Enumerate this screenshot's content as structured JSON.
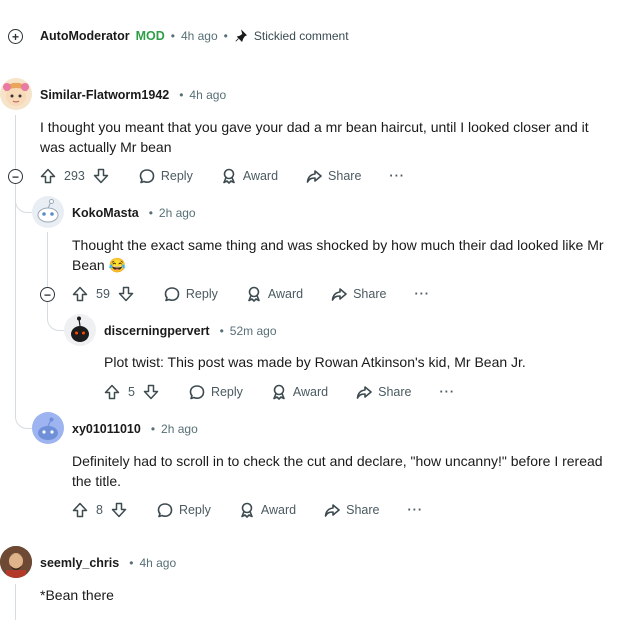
{
  "comments": [
    {
      "user": "AutoModerator",
      "badge": "MOD",
      "time": "4h ago",
      "sticky": "Stickied comment"
    },
    {
      "user": "Similar-Flatworm1942",
      "time": "4h ago",
      "body": "I thought you meant that you gave your dad a mr bean haircut, until I looked closer and it was actually Mr bean",
      "votes": "293",
      "reply": "Reply",
      "award": "Award",
      "share": "Share",
      "more": "···"
    },
    {
      "user": "KokoMasta",
      "time": "2h ago",
      "body": "Thought the exact same thing and was shocked by how much their dad looked like Mr Bean 😂",
      "votes": "59",
      "reply": "Reply",
      "award": "Award",
      "share": "Share",
      "more": "···"
    },
    {
      "user": "discerningpervert",
      "time": "52m ago",
      "body": "Plot twist: This post was made by Rowan Atkinson's kid, Mr Bean Jr.",
      "votes": "5",
      "reply": "Reply",
      "award": "Award",
      "share": "Share",
      "more": "···"
    },
    {
      "user": "xy01011010",
      "time": "2h ago",
      "body": "Definitely had to scroll in to check the cut and declare, \"how uncanny!\" before I reread the title.",
      "votes": "8",
      "reply": "Reply",
      "award": "Award",
      "share": "Share",
      "more": "···"
    },
    {
      "user": "seemly_chris",
      "time": "4h ago",
      "body": "*Bean there"
    }
  ],
  "colors": {
    "mod": "#2e9e47",
    "thread": "#d6dde0",
    "meta": "#576f76"
  }
}
